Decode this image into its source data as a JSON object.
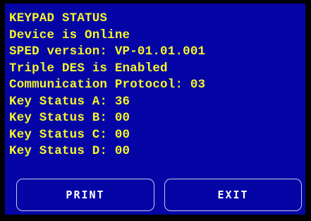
{
  "screen": {
    "title": "KEYPAD STATUS",
    "lines": [
      "Device is Online",
      "SPED version: VP-01.01.001",
      "Triple DES is Enabled",
      "Communication Protocol: 03",
      "Key Status A: 36",
      "Key Status B: 00",
      "Key Status C: 00",
      "Key Status D: 00"
    ]
  },
  "buttons": {
    "print_label": "PRINT",
    "exit_label": "EXIT"
  },
  "colors": {
    "background": "#0505A6",
    "text": "#F5F52A",
    "button_text": "#FFFFFF",
    "button_border": "#C9C9E6"
  }
}
